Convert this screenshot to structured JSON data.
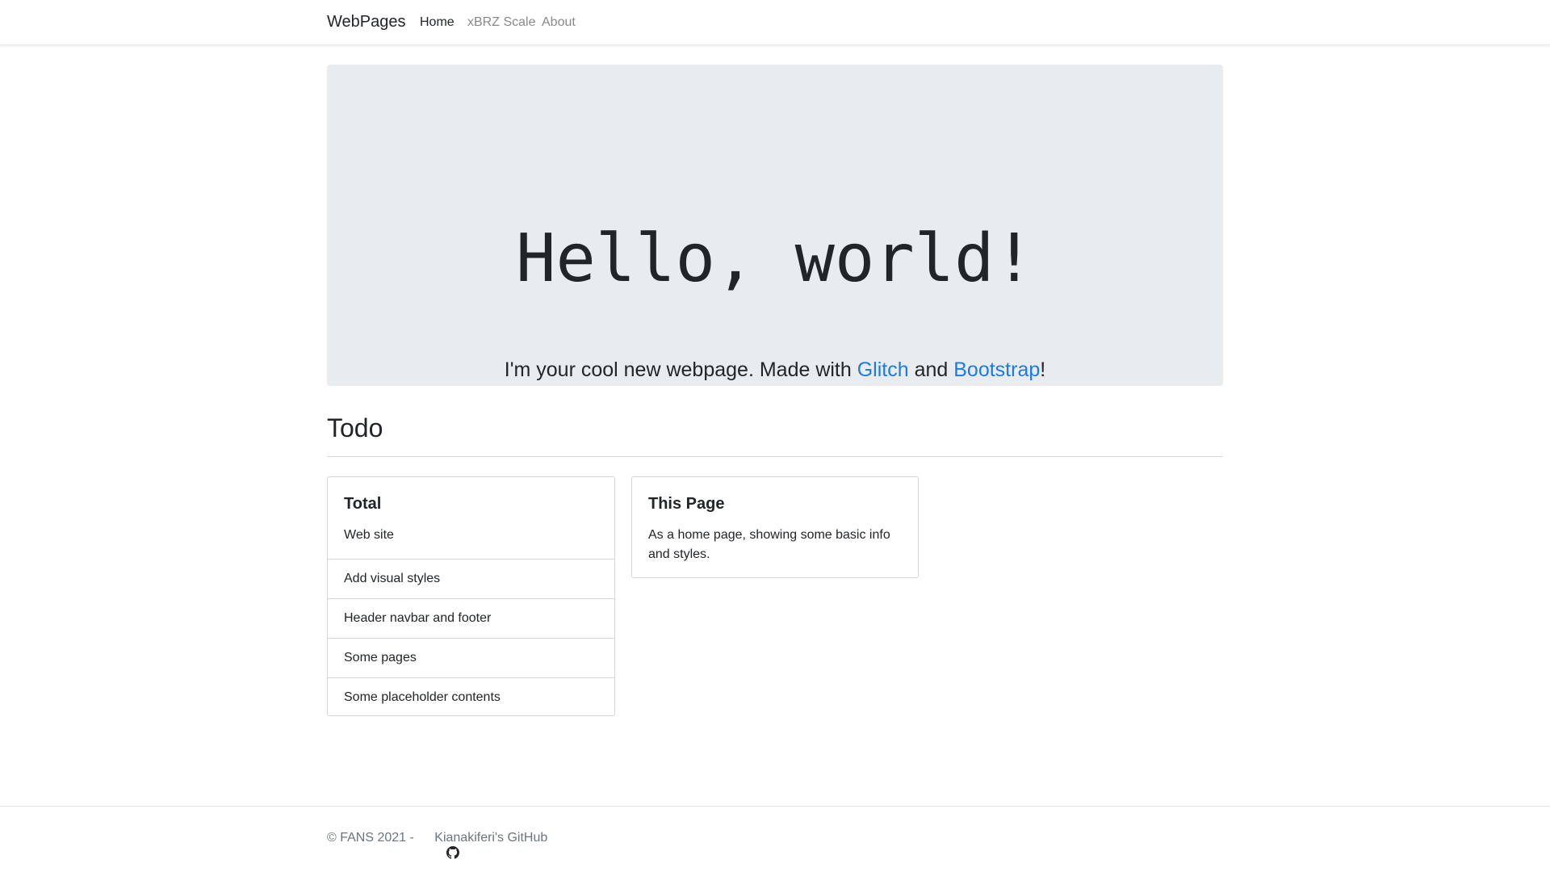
{
  "navbar": {
    "brand": "WebPages",
    "links": [
      {
        "label": "Home",
        "active": true
      },
      {
        "label": "xBRZ Scale",
        "active": false
      },
      {
        "label": "About",
        "active": false
      }
    ]
  },
  "hero": {
    "title": "Hello, world!",
    "lead_prefix": "I'm your cool new webpage. Made with ",
    "link1": "Glitch",
    "lead_middle": " and ",
    "link2": "Bootstrap",
    "lead_suffix": "!"
  },
  "todo": {
    "heading": "Todo",
    "total_card": {
      "title": "Total",
      "text": "Web site",
      "items": [
        "Add visual styles",
        "Header navbar and footer",
        "Some pages",
        "Some placeholder contents"
      ]
    },
    "page_card": {
      "title": "This Page",
      "text": "As a home page, showing some basic info and styles."
    }
  },
  "footer": {
    "copyright": "© FANS 2021 - ",
    "github_icon": "github-icon",
    "github_link": "Kianakiferi's GitHub"
  },
  "colors": {
    "link": "#1f7ae0",
    "jumbotron_bg": "#e9ecef",
    "muted": "#6c757d"
  }
}
